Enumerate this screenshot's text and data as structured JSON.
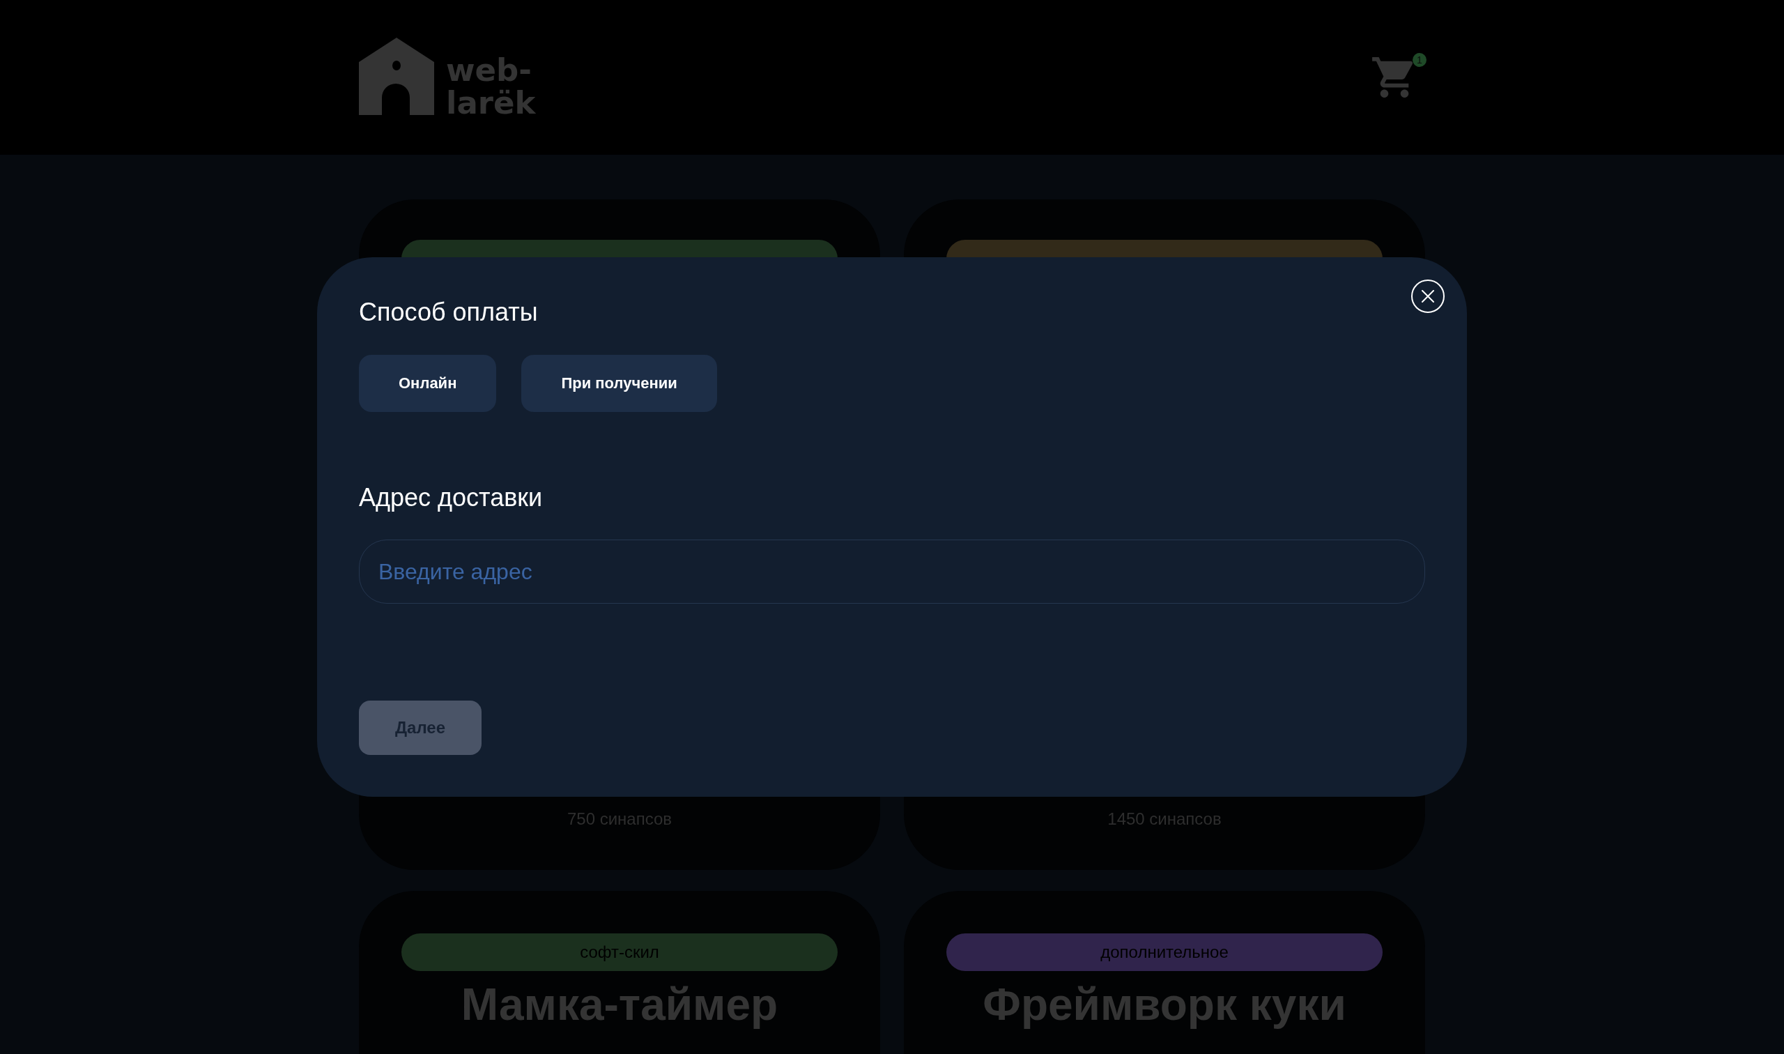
{
  "header": {
    "logo_lines": [
      "web-",
      "larëk"
    ],
    "cart_count": "1"
  },
  "cards": [
    {
      "category": {
        "color": "#1b301e"
      },
      "price": "750 синапсов"
    },
    {
      "category": {
        "color": "#322a19"
      },
      "price": "1450 синапсов"
    },
    {
      "category": {
        "label": "софт-скил",
        "color": "#1b301e"
      },
      "title": "Мамка-таймер"
    },
    {
      "category": {
        "label": "дополнительное",
        "color": "#30244c"
      },
      "title": "Фреймворк куки"
    }
  ],
  "modal": {
    "payment_title": "Способ оплаты",
    "payment_options": [
      {
        "label": "Онлайн",
        "selected": false
      },
      {
        "label": "При получении",
        "selected": false
      }
    ],
    "address_title": "Адрес доставки",
    "address_field": {
      "placeholder": "Введите адрес"
    },
    "next_button": {
      "label": "Далее",
      "disabled": true
    }
  }
}
